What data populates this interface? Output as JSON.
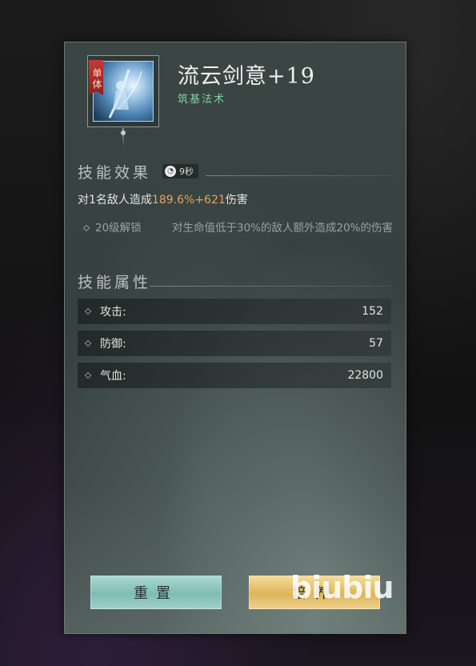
{
  "skill": {
    "target_tag": "单体",
    "name": "流云剑意+19",
    "type": "筑基法术"
  },
  "effect_section": {
    "title": "技能效果",
    "cooldown": "9秒",
    "desc_prefix": "对1名敌人造成",
    "desc_percent": "189.6%",
    "desc_plus": "+",
    "desc_flat": "621",
    "desc_suffix": "伤害",
    "unlock": {
      "level": "20级解锁",
      "description": "对生命值低于30%的敌人额外造成20%的伤害"
    }
  },
  "attr_section": {
    "title": "技能属性",
    "rows": [
      {
        "label": "攻击:",
        "value": "152"
      },
      {
        "label": "防御:",
        "value": "57"
      },
      {
        "label": "气血:",
        "value": "22800"
      }
    ]
  },
  "buttons": {
    "reset": "重置",
    "cultivate": "培养"
  },
  "watermark": "biubiu",
  "colors": {
    "highlight": "#e9a15b",
    "skill_type": "#7fd1a4",
    "reset_button": "#8ec7bf",
    "cultivate_button": "#e6c46f",
    "target_tag": "#b0322a"
  }
}
